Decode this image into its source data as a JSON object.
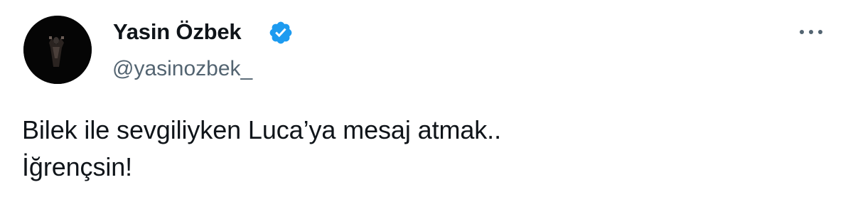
{
  "author": {
    "display_name": "Yasin Özbek",
    "handle": "@yasinozbek_",
    "verified": true,
    "verified_badge_icon": "verified-badge-icon",
    "verified_color": "#1d9bf0",
    "avatar_icon": "avatar-photo"
  },
  "menu": {
    "more_icon": "more-options-icon"
  },
  "tweet": {
    "lines": [
      "Bilek ile sevgiliyken Luca’ya mesaj atmak..",
      "İğrençsin!"
    ]
  },
  "colors": {
    "text_primary": "#0f1419",
    "text_secondary": "#536471",
    "background": "#ffffff"
  }
}
